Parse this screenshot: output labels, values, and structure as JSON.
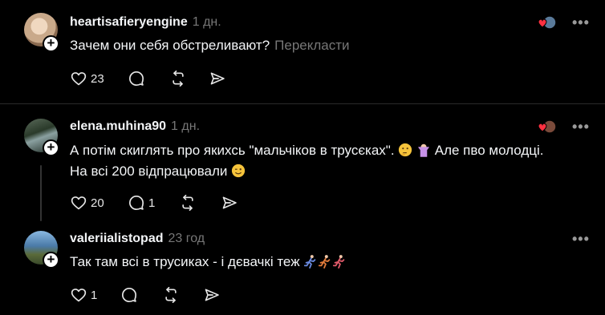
{
  "posts": [
    {
      "username": "heartisafieryengine",
      "time": "1 дн.",
      "text": "Зачем они себя обстреливают?",
      "translate_label": "Перекласти",
      "likes": "23",
      "replies": "",
      "menu_label": "•••",
      "avatar_color": "#c9a98a"
    },
    {
      "username": "elena.muhina90",
      "time": "1 дн.",
      "text_line1": "А потім скиглять про якихсь \"мальчіков в трусєках\".",
      "text_line1_tail": "Але пво молодці.",
      "text_line2": "На всі 200 відпрацювали",
      "likes": "20",
      "replies": "1",
      "menu_label": "•••",
      "avatar_color": "#3a4a3a"
    },
    {
      "username": "valeriialistopad",
      "time": "23 год",
      "text": "Так там всі в трусиках - і дєвачкі теж",
      "likes": "1",
      "replies": "",
      "menu_label": "•••",
      "avatar_color": "#4a7aa8"
    }
  ],
  "icons": {
    "like": "heart-icon",
    "reply": "speech-bubble-icon",
    "repost": "repost-icon",
    "share": "send-icon",
    "follow": "plus-icon"
  },
  "colors": {
    "background": "#000000",
    "text": "#f3f5f7",
    "muted": "#777777",
    "divider": "#2a2a2a",
    "reaction_heart": "#ff3040"
  }
}
